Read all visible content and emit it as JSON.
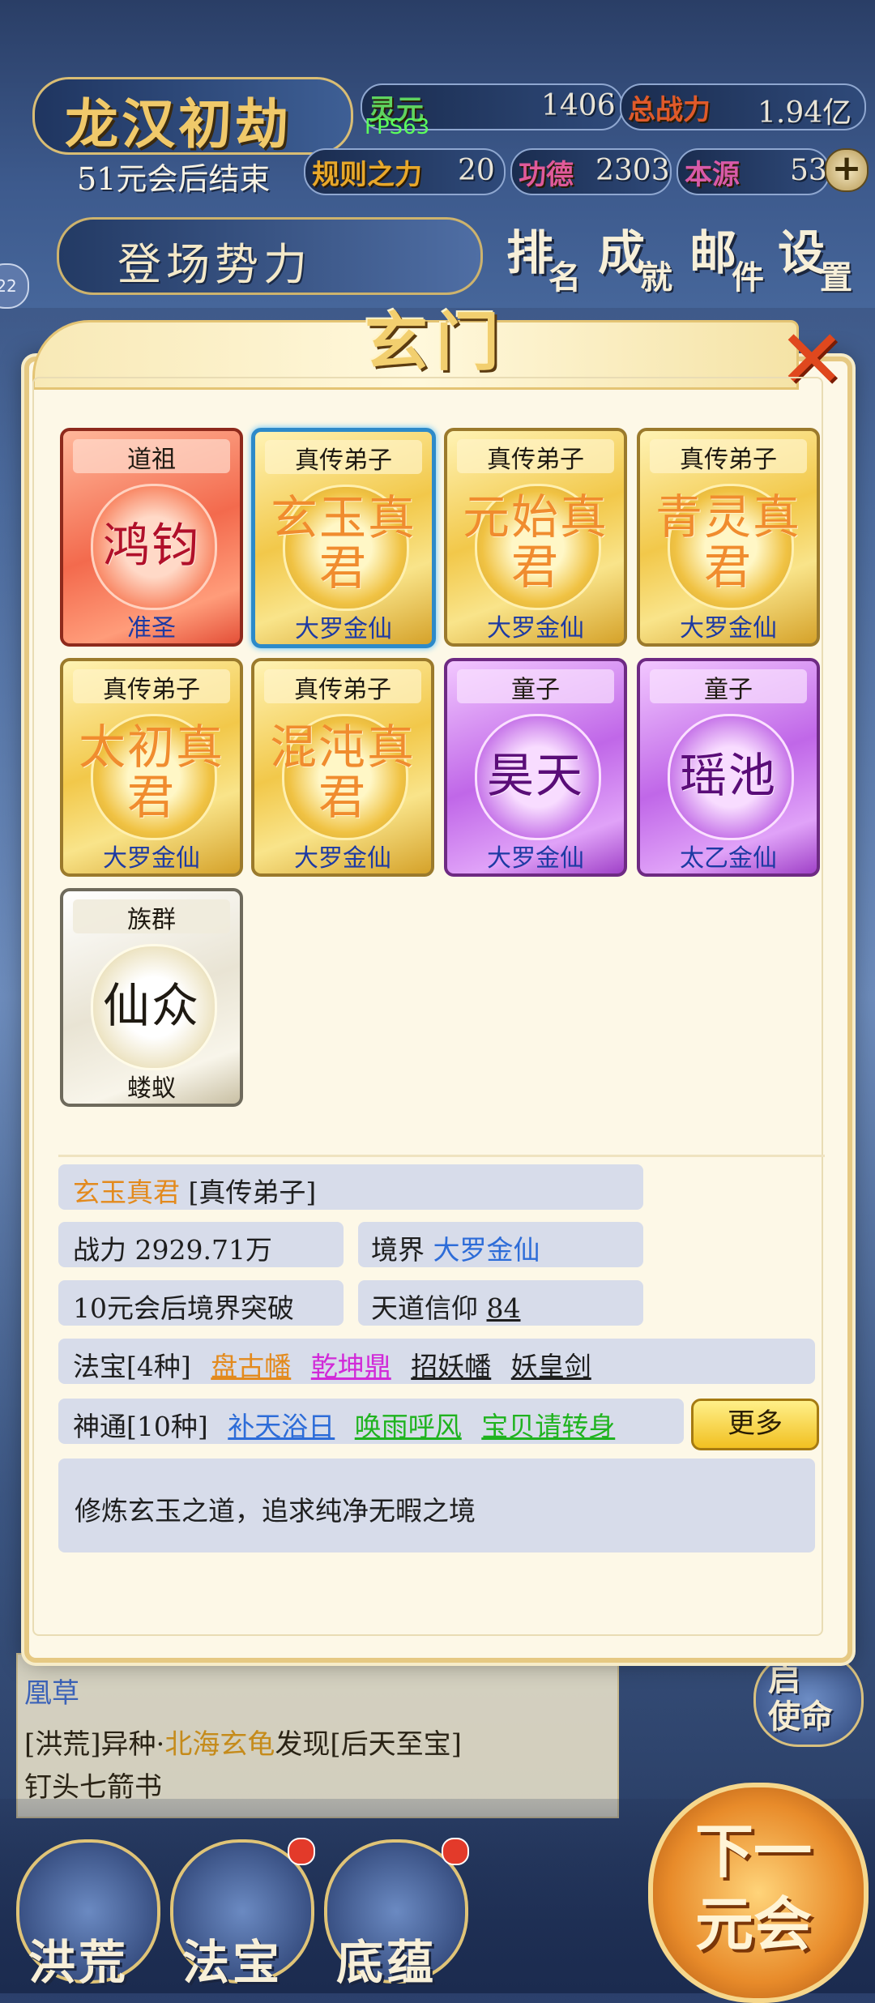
{
  "hud": {
    "title": "龙汉初劫",
    "countdown": "51元会后结束",
    "fps": "FPS63",
    "stats": {
      "lingyuan_label": "灵元",
      "lingyuan_value": "1406",
      "power_label": "总战力",
      "power_value": "1.94亿",
      "rule_label": "规则之力",
      "rule_value": "20",
      "merit_label": "功德",
      "merit_value": "2303",
      "origin_label": "本源",
      "origin_value": "53"
    },
    "plus": "+",
    "faction_tab": "登场势力",
    "menu": [
      {
        "c1": "排",
        "c2": "名"
      },
      {
        "c1": "成",
        "c2": "就"
      },
      {
        "c1": "邮",
        "c2": "件"
      },
      {
        "c1": "设",
        "c2": "置"
      }
    ],
    "side_bubble": "22"
  },
  "modal": {
    "title": "玄门",
    "close": "✕",
    "cards": [
      {
        "rank": "道祖",
        "name": "鸿钧",
        "realm": "准圣",
        "style": "red"
      },
      {
        "rank": "真传弟子",
        "name": "玄玉真君",
        "realm": "大罗金仙",
        "style": "gold"
      },
      {
        "rank": "真传弟子",
        "name": "元始真君",
        "realm": "大罗金仙",
        "style": "gold"
      },
      {
        "rank": "真传弟子",
        "name": "青灵真君",
        "realm": "大罗金仙",
        "style": "gold"
      },
      {
        "rank": "真传弟子",
        "name": "太初真君",
        "realm": "大罗金仙",
        "style": "gold"
      },
      {
        "rank": "真传弟子",
        "name": "混沌真君",
        "realm": "大罗金仙",
        "style": "gold"
      },
      {
        "rank": "童子",
        "name": "昊天",
        "realm": "大罗金仙",
        "style": "purple"
      },
      {
        "rank": "童子",
        "name": "瑶池",
        "realm": "太乙金仙",
        "style": "purple"
      },
      {
        "rank": "族群",
        "name": "仙众",
        "realm": "蝼蚁",
        "style": "silver"
      }
    ],
    "selected_index": 1,
    "detail": {
      "name": "玄玉真君",
      "rank_tag": "[真传弟子]",
      "power_label": "战力",
      "power_value": "2929.71万",
      "realm_label": "境界",
      "realm_value": "大罗金仙",
      "breakthrough": "10元会后境界突破",
      "faith_label": "天道信仰",
      "faith_value": "84",
      "treasure_label": "法宝[4种]",
      "treasures": [
        "盘古幡",
        "乾坤鼎",
        "招妖幡",
        "妖皇剑"
      ],
      "treasure_colors": [
        "#e38a1d",
        "#d12ad8",
        "#1e1e1e",
        "#1e1e1e"
      ],
      "skill_label": "神通[10种]",
      "skills": [
        "补天浴日",
        "唤雨呼风",
        "宝贝请转身"
      ],
      "skill_colors": [
        "#2d6cd8",
        "#1fb31f",
        "#1fb31f"
      ],
      "more": "更多",
      "description": "修炼玄玉之道，追求纯净无暇之境"
    }
  },
  "log": {
    "line1_a": "凰草",
    "line2_a": "[洪荒]异种·",
    "line2_b": "北海玄龟",
    "line2_c": "发现[后天至宝]",
    "line3": "钉头七箭书"
  },
  "mission": {
    "a": "启",
    "b": "使命"
  },
  "nav": {
    "honghuang": "洪荒",
    "fabao": "法宝",
    "diyun": "底蕴",
    "next_a": "下一",
    "next_b": "元会"
  }
}
